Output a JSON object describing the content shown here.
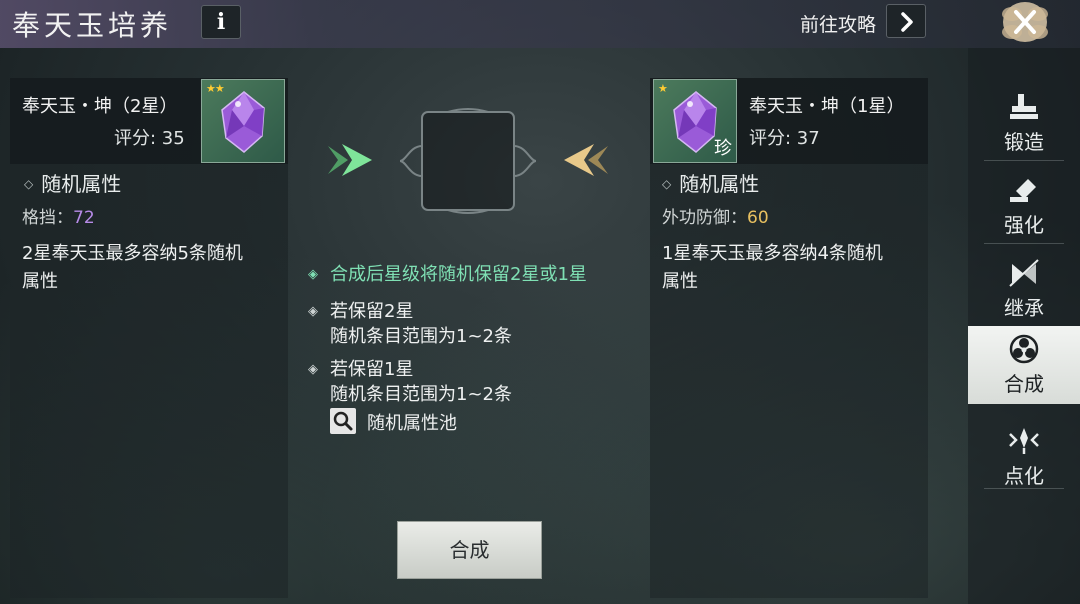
{
  "header": {
    "title": "奉天玉培养",
    "info_label": "i",
    "guide_label": "前往攻略"
  },
  "left_item": {
    "name": "奉天玉・坤（2星）",
    "score": "评分: 35",
    "stars": "★★",
    "section_title": "随机属性",
    "attr_name": "格挡：",
    "attr_value": "72",
    "desc_line1": "2星奉天玉最多容纳5条随机",
    "desc_line2": "属性"
  },
  "right_item": {
    "name": "奉天玉・坤（1星）",
    "score": "评分: 37",
    "stars": "★",
    "rare_tag": "珍",
    "section_title": "随机属性",
    "attr_name": "外功防御：",
    "attr_value": "60",
    "desc_line1": "1星奉天玉最多容纳4条随机",
    "desc_line2": "属性"
  },
  "center": {
    "tip1": "合成后星级将随机保留2星或1星",
    "tip2_title": "若保留2星",
    "tip2_detail": "随机条目范围为1~2条",
    "tip3_title": "若保留1星",
    "tip3_detail": "随机条目范围为1~2条",
    "pool_label": "随机属性池",
    "compose_button": "合成"
  },
  "sidebar": {
    "items": [
      {
        "label": "锻造",
        "icon": "anvil-icon"
      },
      {
        "label": "强化",
        "icon": "hammer-icon"
      },
      {
        "label": "继承",
        "icon": "inherit-icon"
      },
      {
        "label": "合成",
        "icon": "compose-icon",
        "active": true
      },
      {
        "label": "点化",
        "icon": "enlighten-icon"
      }
    ]
  },
  "colors": {
    "accent_green": "#7fe0b4",
    "attr_purple": "#b78be8",
    "attr_gold": "#e8c060",
    "star_gold": "#ffcc33"
  }
}
